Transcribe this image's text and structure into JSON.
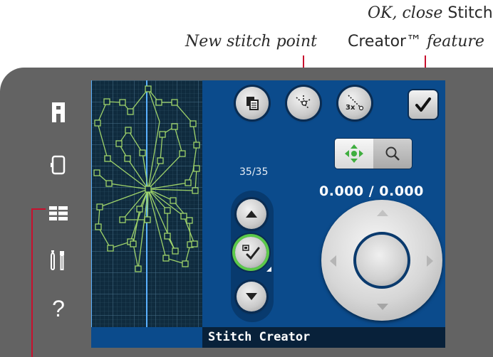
{
  "callouts": {
    "new_stitch_point": "New stitch point",
    "ok_close_line1_italic": "OK, close",
    "ok_close_line1_plain": "Stitch",
    "ok_close_line2_plain": "Creator™",
    "ok_close_line2_italic": "feature"
  },
  "screen": {
    "counter": "35/35",
    "coordinates": "0.000 / 0.000",
    "status_title": "Stitch Creator"
  },
  "left_rail": {
    "help_glyph": "?"
  },
  "colors": {
    "frame": "#636363",
    "screen_bg": "#0b4b8c",
    "grid_bg": "#0f2b3e",
    "stitch_line": "#9fd36a",
    "leader_red": "#c8102e",
    "ring_green": "#5cc94a"
  },
  "icons": {
    "rail": [
      "h-menu-icon",
      "fabric-icon",
      "stitch-list-icon",
      "tools-icon",
      "help-icon"
    ],
    "top_buttons": [
      "duplicate-icon",
      "new-stitch-point-icon",
      "triple-stitch-icon",
      "checkmark-icon"
    ],
    "toggles": [
      "move-arrows-icon",
      "zoom-icon"
    ]
  }
}
